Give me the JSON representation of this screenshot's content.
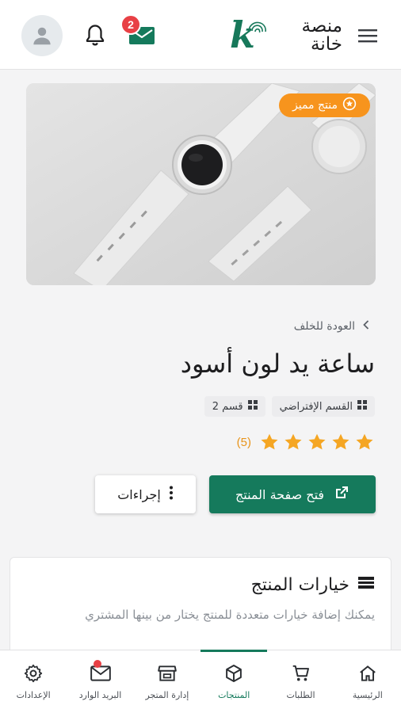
{
  "header": {
    "mail_badge_count": "2",
    "logo_letter": "k",
    "logo_line1": "منصة",
    "logo_line2": "خانة",
    "icons": {
      "menu": "menu-icon",
      "mail": "mail-icon",
      "bell": "bell-icon",
      "avatar": "user-avatar-icon"
    }
  },
  "hero": {
    "badge_label": "منتج مميز",
    "badge_icon": "star-circle-icon"
  },
  "product": {
    "back_label": "العودة للخلف",
    "title": "ساعة يد لون أسود",
    "categories": [
      {
        "label": "القسم الإفتراضي",
        "icon": "grid-icon"
      },
      {
        "label": "قسم 2",
        "icon": "grid-icon"
      }
    ],
    "rating": {
      "stars": 5,
      "count_label": "(5)"
    }
  },
  "actions": {
    "open_page_label": "فتح صفحة المنتج",
    "more_label": "إجراءات"
  },
  "options_card": {
    "title": "خيارات المنتج",
    "description": "يمكنك إضافة خيارات متعددة للمنتج يختار من بينها المشتري"
  },
  "bottom_nav": [
    {
      "label": "الرئيسية",
      "icon": "home-icon",
      "active": false
    },
    {
      "label": "الطلبات",
      "icon": "cart-icon",
      "active": false
    },
    {
      "label": "المنتجات",
      "icon": "box-icon",
      "active": true
    },
    {
      "label": "إدارة المتجر",
      "icon": "store-icon",
      "active": false
    },
    {
      "label": "البريد الوارد",
      "icon": "inbox-icon",
      "active": false,
      "dot": true
    },
    {
      "label": "الإعدادات",
      "icon": "settings-icon",
      "active": false
    }
  ],
  "colors": {
    "brand": "#157a5c",
    "badge_orange": "#f7941d",
    "star": "#f5a623",
    "notification": "#e84045"
  }
}
